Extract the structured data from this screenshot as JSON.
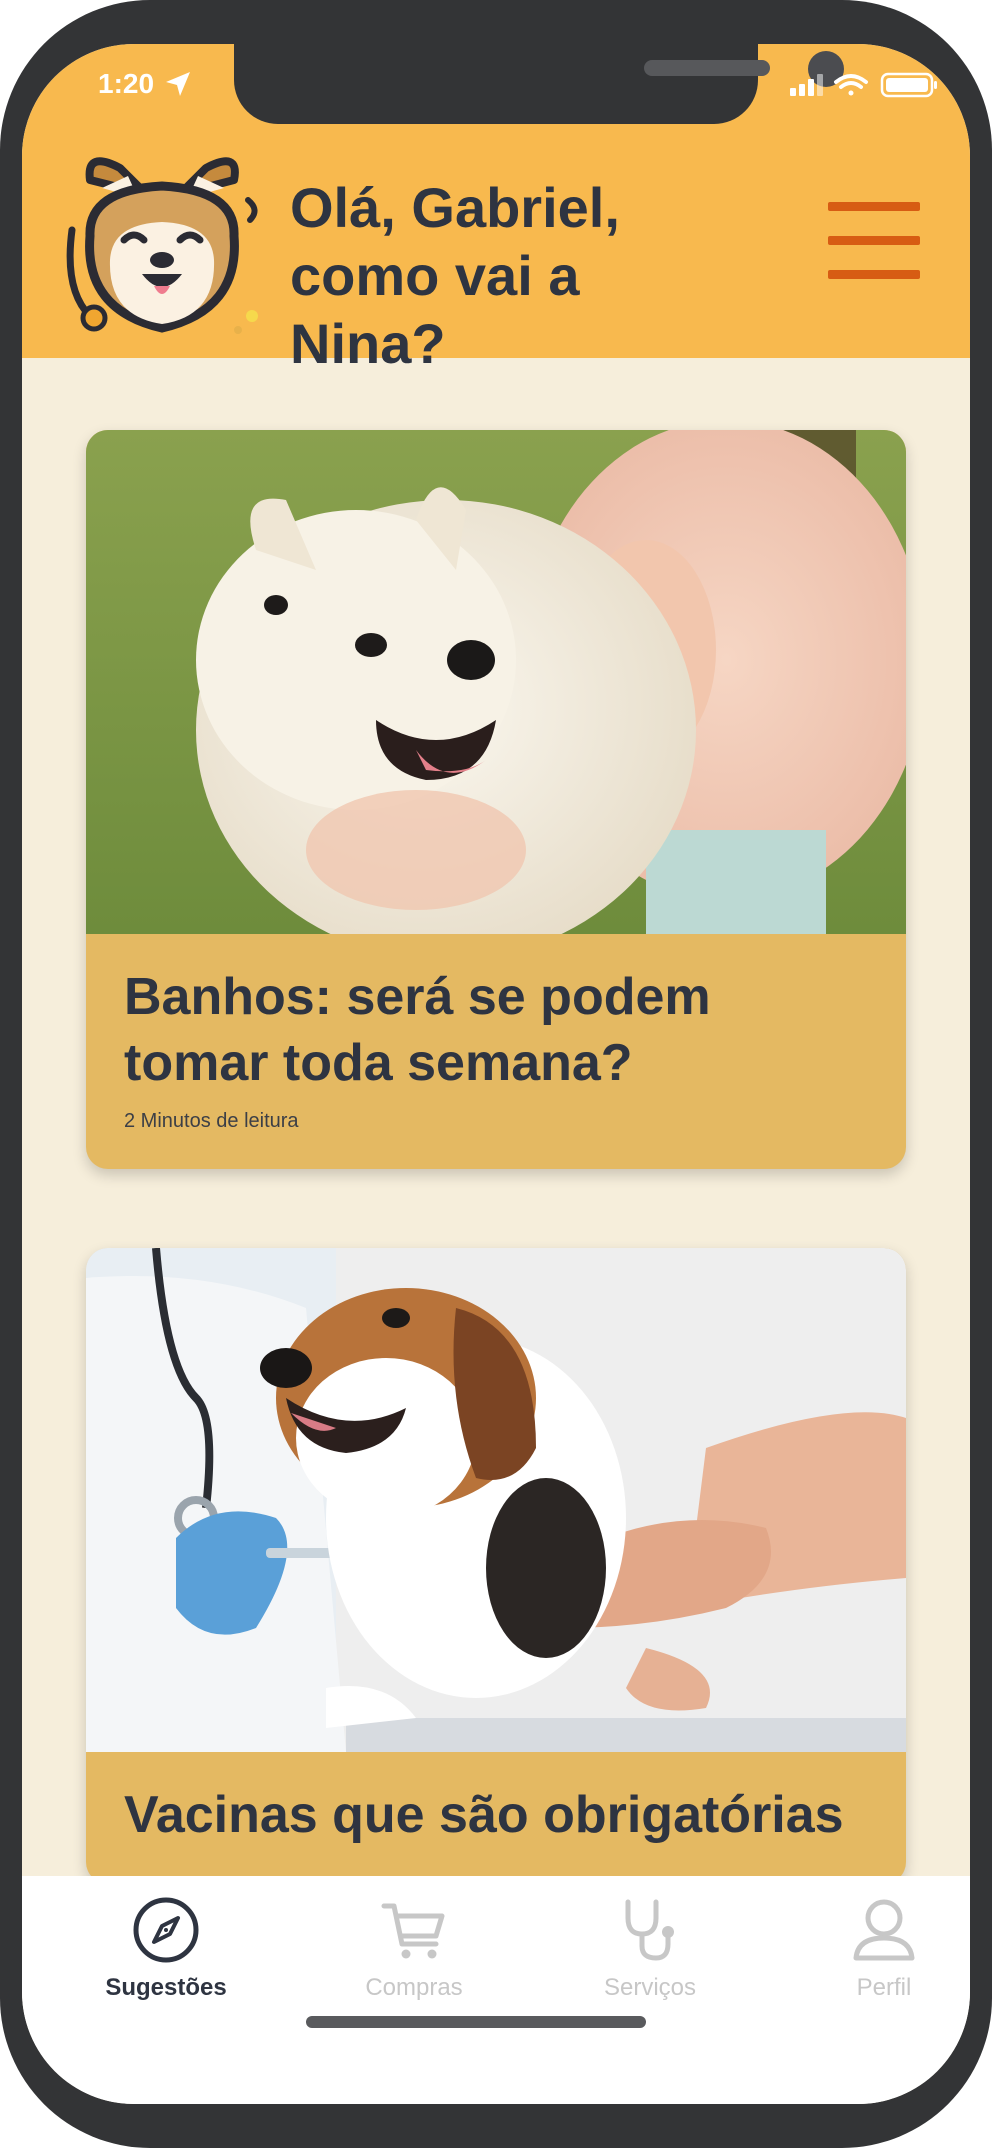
{
  "status_bar": {
    "time": "1:20"
  },
  "header": {
    "greeting_line1": "Olá, Gabriel,",
    "greeting_line2": "como vai a Nina?"
  },
  "articles": [
    {
      "title": "Banhos: será se podem tomar toda semana?",
      "meta": "2 Minutos de leitura"
    },
    {
      "title": "Vacinas que são obrigatórias"
    }
  ],
  "tabs": [
    {
      "label": "Sugestões",
      "icon": "compass-icon",
      "active": true
    },
    {
      "label": "Compras",
      "icon": "cart-icon",
      "active": false
    },
    {
      "label": "Serviços",
      "icon": "stethoscope-icon",
      "active": false
    },
    {
      "label": "Perfil",
      "icon": "user-icon",
      "active": false
    }
  ],
  "colors": {
    "header_bg": "#f8b94e",
    "page_bg": "#f6eedb",
    "card_bg": "#e4b962",
    "text_dark": "#2e3441",
    "menu_orange": "#d75c13",
    "tab_inactive": "#c7c7c7"
  }
}
